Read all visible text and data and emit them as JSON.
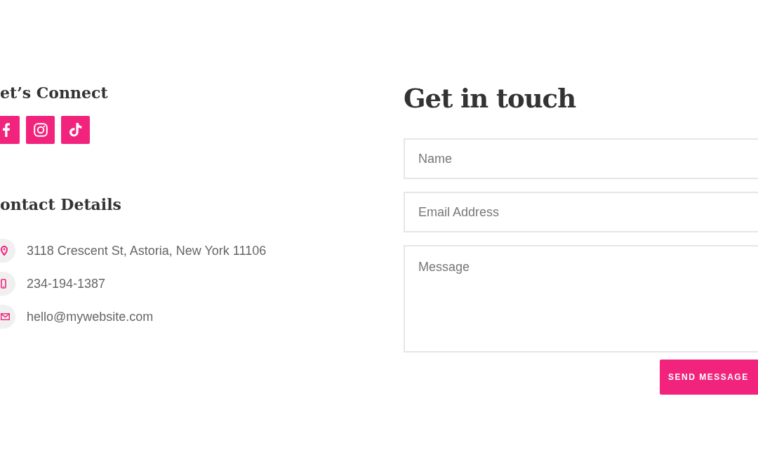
{
  "connect": {
    "heading": "et’s Connect",
    "social": [
      {
        "kind": "facebook"
      },
      {
        "kind": "instagram"
      },
      {
        "kind": "tiktok"
      }
    ]
  },
  "contact_details": {
    "heading": "ontact Details",
    "items": [
      {
        "kind": "location",
        "text": "3118 Crescent St, Astoria, New York 11106"
      },
      {
        "kind": "phone",
        "text": "234-194-1387"
      },
      {
        "kind": "email",
        "text": "hello@mywebsite.com"
      }
    ]
  },
  "form": {
    "heading": "Get in touch",
    "fields": [
      {
        "kind": "input",
        "placeholder": "Name"
      },
      {
        "kind": "input",
        "placeholder": "Email Address"
      },
      {
        "kind": "textarea",
        "placeholder": "Message"
      }
    ],
    "submit": "SEND MESSAGE"
  }
}
